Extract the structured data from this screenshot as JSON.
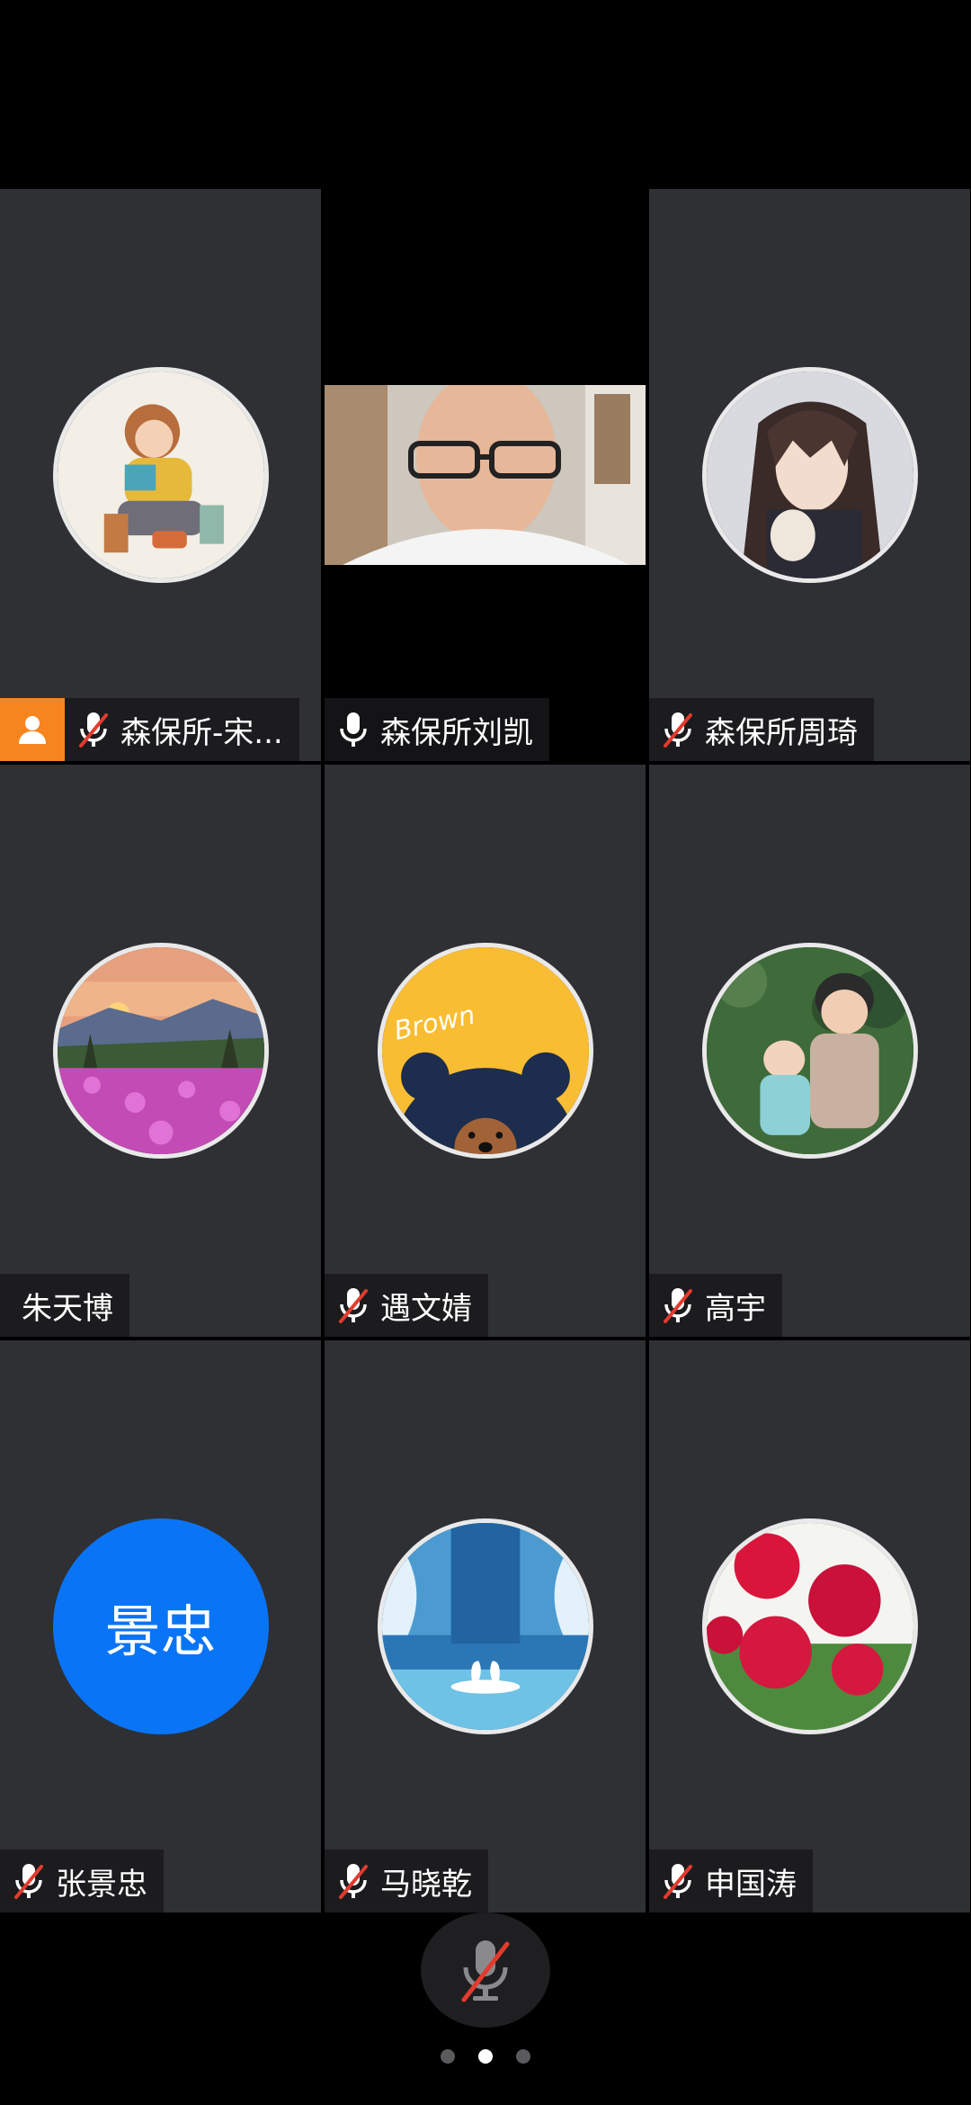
{
  "participants": [
    {
      "name": "森保所-宋...",
      "mic": "muted",
      "host": true,
      "avatar": "illustration-girl-reading"
    },
    {
      "name": "森保所刘凯",
      "mic": "on",
      "video": true,
      "avatar": "video-feed"
    },
    {
      "name": "森保所周琦",
      "mic": "muted",
      "avatar": "anime-character"
    },
    {
      "name": "朱天博",
      "mic": "none",
      "avatar": "flower-field-sunset"
    },
    {
      "name": "遇文婧",
      "mic": "muted",
      "avatar": "brown-bear-cartoon",
      "avatar_text": "Brown"
    },
    {
      "name": "高宇",
      "mic": "muted",
      "avatar": "child-with-doll"
    },
    {
      "name": "张景忠",
      "mic": "muted",
      "avatar": "initials",
      "avatar_text": "景忠"
    },
    {
      "name": "马晓乾",
      "mic": "muted",
      "avatar": "swans-waterfall"
    },
    {
      "name": "申国涛",
      "mic": "muted",
      "avatar": "red-flowers"
    }
  ],
  "controls": {
    "mic_button_state": "muted",
    "mic_icon": "mic-muted-icon"
  },
  "pagination": {
    "total_pages": 3,
    "current_page": 2
  },
  "colors": {
    "tile_bg": "#2f3033",
    "host_badge": "#f7851f",
    "initials_avatar": "#0a74f7",
    "mute_slash": "#e23b2e"
  }
}
